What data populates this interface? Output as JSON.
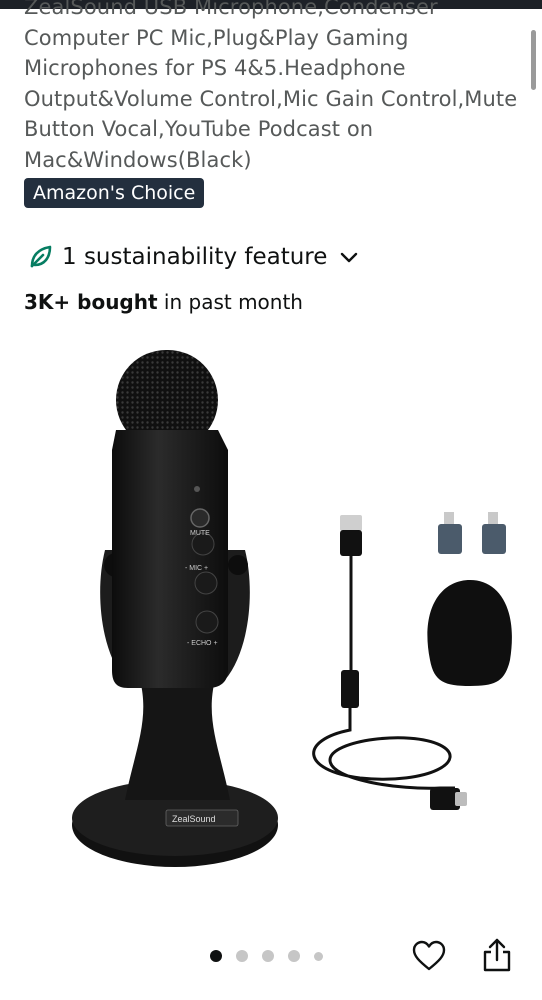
{
  "title": {
    "lines": [
      "ZealSound USB Microphone,Condenser",
      "Computer PC Mic,Plug&Play Gaming",
      "Microphones for PS 4&5.Headphone",
      "Output&Volume Control,Mic Gain Control,Mute",
      "Button Vocal,YouTube Podcast on",
      "Mac&Windows(Black)"
    ]
  },
  "badge": {
    "label": "Amazon's Choice"
  },
  "sustainability": {
    "label": "1 sustainability feature"
  },
  "bought": {
    "bold": "3K+ bought",
    "rest": " in past month"
  },
  "product_image": {
    "mic_labels": {
      "mute": "MUTE",
      "mic": "- MIC +",
      "echo": "- ECHO +",
      "brand": "ZealSound"
    }
  },
  "carousel": {
    "count": 5,
    "active_index": 0
  },
  "colors": {
    "badge_bg": "#232f3e",
    "leaf": "#067d62",
    "text": "#0f1111"
  }
}
